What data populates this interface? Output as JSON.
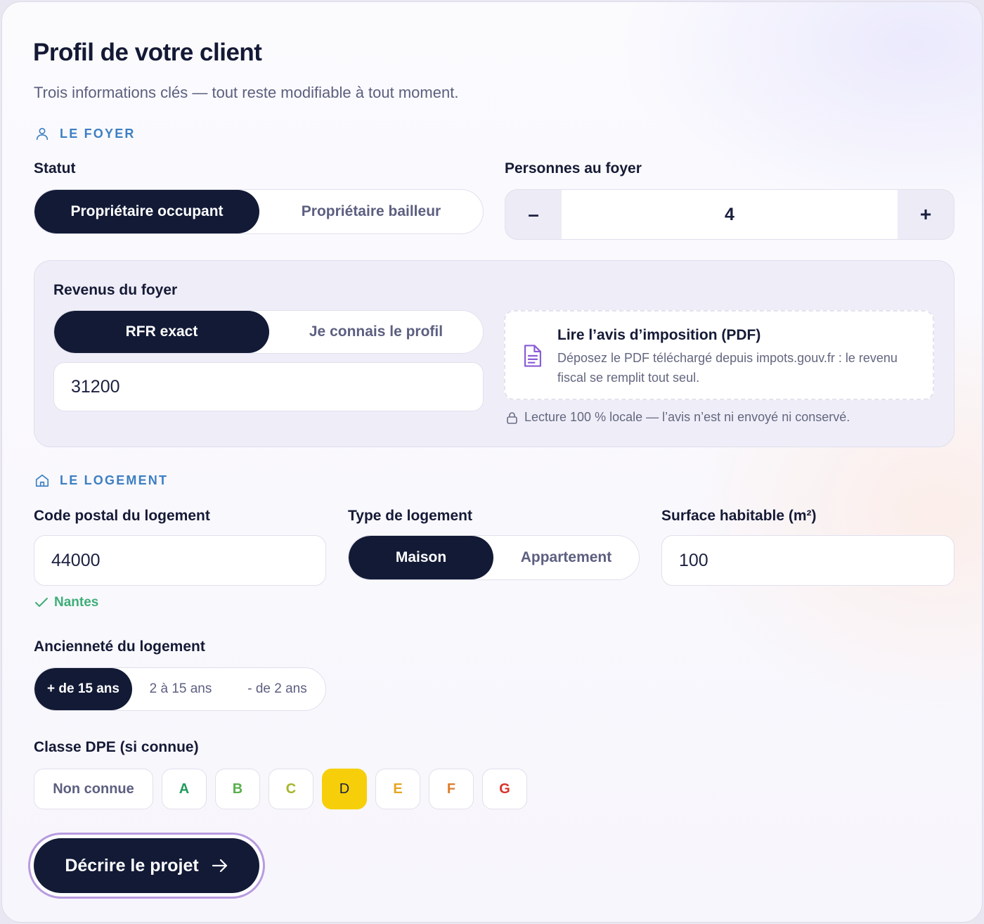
{
  "header": {
    "title": "Profil de votre client",
    "subtitle": "Trois informations clés — tout reste modifiable à tout moment."
  },
  "foyer": {
    "section_label": "LE FOYER",
    "statut_label": "Statut",
    "statut_options": [
      "Propriétaire occupant",
      "Propriétaire bailleur"
    ],
    "statut_selected": "Propriétaire occupant",
    "personnes_label": "Personnes au foyer",
    "personnes_minus": "–",
    "personnes_value": "4",
    "personnes_plus": "+"
  },
  "revenus": {
    "label": "Revenus du foyer",
    "mode_options": [
      "RFR exact",
      "Je connais le profil"
    ],
    "mode_selected": "RFR exact",
    "rfr_value": "31200",
    "pdf_title": "Lire l’avis d’imposition (PDF)",
    "pdf_description": "Déposez le PDF téléchargé depuis impots.gouv.fr : le revenu fiscal se remplit tout seul.",
    "privacy_note": "Lecture 100 % locale — l’avis n’est ni envoyé ni conservé."
  },
  "logement": {
    "section_label": "LE LOGEMENT",
    "code_postal_label": "Code postal du logement",
    "code_postal_value": "44000",
    "city": "Nantes",
    "type_label": "Type de logement",
    "type_options": [
      "Maison",
      "Appartement"
    ],
    "type_selected": "Maison",
    "surface_label": "Surface habitable (m²)",
    "surface_value": "100",
    "anciennete_label": "Ancienneté du logement",
    "anciennete_options": [
      "+ de 15 ans",
      "2 à 15 ans",
      "- de 2 ans"
    ],
    "anciennete_selected": "+ de 15 ans",
    "dpe_label": "Classe DPE (si connue)",
    "dpe_options": [
      "Non connue",
      "A",
      "B",
      "C",
      "D",
      "E",
      "F",
      "G"
    ],
    "dpe_selected": "D",
    "dpe_colors": {
      "A": "#1f9a5b",
      "B": "#57b04a",
      "C": "#a7b52a",
      "D": "#f6cf0a",
      "E": "#e6a621",
      "F": "#df7d2c",
      "G": "#d8342c"
    }
  },
  "cta": {
    "label": "Décrire le projet"
  },
  "icons": {
    "foyer": "user-icon",
    "logement": "house-icon",
    "pdf": "document-icon",
    "privacy": "lock-icon",
    "city_check": "check-icon",
    "cta_arrow": "arrow-right-icon"
  }
}
